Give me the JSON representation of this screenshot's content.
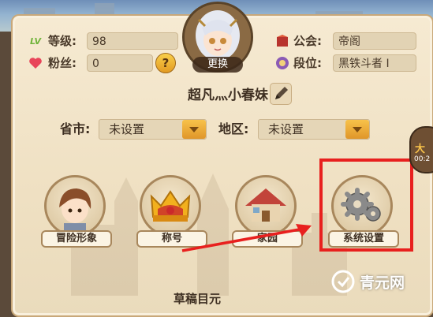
{
  "player": {
    "level_label": "等级:",
    "level_value": "98",
    "fans_label": "粉丝:",
    "fans_value": "0",
    "guild_label": "公会:",
    "guild_value": "帝阁",
    "rank_label": "段位:",
    "rank_value": "黑铁斗者 I",
    "name": "超凡灬小春妹",
    "change_avatar_label": "更换",
    "level_badge": "LV",
    "help_glyph": "?"
  },
  "location": {
    "province_label": "省市:",
    "province_value": "未设置",
    "region_label": "地区:",
    "region_value": "未设置"
  },
  "features": [
    {
      "label": "冒险形象",
      "icon": "adventurer-icon"
    },
    {
      "label": "称号",
      "icon": "crown-icon"
    },
    {
      "label": "家园",
      "icon": "house-icon"
    },
    {
      "label": "系统设置",
      "icon": "gear-icon"
    }
  ],
  "side_widget": {
    "text": "大",
    "timer": "00:2"
  },
  "bottom_title": "草稿目元",
  "watermark": "青元网",
  "colors": {
    "highlight": "#e8201e",
    "accent": "#f8c24a",
    "parchment": "#f6ead2"
  }
}
